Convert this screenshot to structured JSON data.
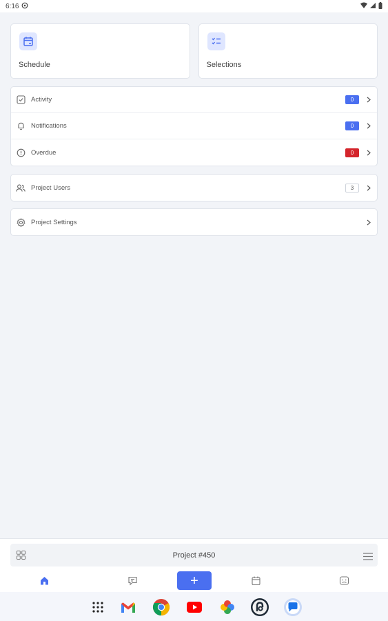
{
  "status_bar": {
    "time": "6:16"
  },
  "tiles": [
    {
      "label": "Schedule",
      "icon": "calendar-icon"
    },
    {
      "label": "Selections",
      "icon": "checklist-icon"
    }
  ],
  "list": [
    {
      "label": "Activity",
      "icon": "check-square-icon",
      "badge": "0",
      "badge_color": "#4a6ff0"
    },
    {
      "label": "Notifications",
      "icon": "bell-icon",
      "badge": "0",
      "badge_color": "#4a6ff0"
    },
    {
      "label": "Overdue",
      "icon": "alert-circle-icon",
      "badge": "0",
      "badge_color": "#d4252c"
    }
  ],
  "users": {
    "label": "Project Users",
    "icon": "users-icon",
    "count": "3"
  },
  "settings": {
    "label": "Project Settings",
    "icon": "gear-icon"
  },
  "project_bar": {
    "title": "Project #450"
  },
  "nav": {
    "add_label": "+",
    "accent": "#4a6ff0",
    "items": [
      "home-icon",
      "chat-icon",
      "add-icon",
      "calendar-icon",
      "face-icon"
    ]
  },
  "dock": {
    "apps": [
      "app-drawer-icon",
      "gmail-icon",
      "chrome-icon",
      "youtube-icon",
      "photos-icon",
      "threads-icon",
      "messages-icon"
    ]
  }
}
